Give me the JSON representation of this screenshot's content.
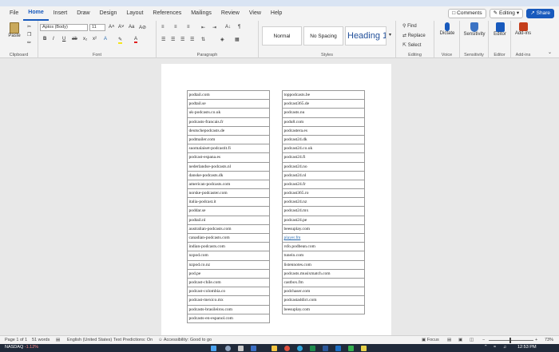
{
  "menu": {
    "items": [
      {
        "label": "File",
        "active": false
      },
      {
        "label": "Home",
        "active": true
      },
      {
        "label": "Insert",
        "active": false
      },
      {
        "label": "Draw",
        "active": false
      },
      {
        "label": "Design",
        "active": false
      },
      {
        "label": "Layout",
        "active": false
      },
      {
        "label": "References",
        "active": false
      },
      {
        "label": "Mailings",
        "active": false
      },
      {
        "label": "Review",
        "active": false
      },
      {
        "label": "View",
        "active": false
      },
      {
        "label": "Help",
        "active": false
      }
    ],
    "comments": "Comments",
    "editing": "Editing",
    "share": "Share"
  },
  "ribbon": {
    "paste": "Paste",
    "clipboard": "Clipboard",
    "font_name": "Aptos (Body)",
    "font_size": "11",
    "font": "Font",
    "paragraph": "Paragraph",
    "styles": "Styles",
    "style_normal": "Normal",
    "style_nospacing": "No Spacing",
    "style_heading": "Heading 1",
    "find": "Find",
    "replace": "Replace",
    "select": "Select",
    "editing": "Editing",
    "dictate": "Dictate",
    "voice": "Voice",
    "sensitivity": "Sensitivity",
    "sensitivity_group": "Sensitivity",
    "editor": "Editor",
    "editor_group": "Editor",
    "addins": "Add-ins",
    "addins_group": "Add-ins"
  },
  "table": {
    "left": [
      "podtail.com",
      "podtail.se",
      "uk-podcasts.co.uk",
      "podcasts-francais.fr",
      "deutschepodcasts.de",
      "podmailer.com",
      "suomalaiset-podcastit.fi",
      "podcast-espana.es",
      "nederlandse-podcasts.nl",
      "danske-podcasts.dk",
      "american-podcasts.com",
      "norske-podcaster.com",
      "italia-podcast.it",
      "poddar.se",
      "podtail.nl",
      "australian-podcasts.com",
      "canadian-podcasts.com",
      "indian-podcasts.com",
      "nzpod.com",
      "nzpod.co.nz",
      "pod.pe",
      "podcast-chile.com",
      "podcast-colombia.co",
      "podcast-mexico.mx",
      "podcasts-brasileiros.com",
      "podcasts-en-espanol.com"
    ],
    "right": [
      "toppodcasts.be",
      "podcast365.de",
      "podcasts.nu",
      "podu8.com",
      "podcastera.es",
      "podcast24.dk",
      "podcast24.co.uk",
      "podcast24.fi",
      "podcast24.no",
      "podcast24.nl",
      "podcast24.fr",
      "podcast365.ro",
      "podcast24.nz",
      "podcast24.mx",
      "podcast24.pe",
      "beesuplay.com",
      "player.fm",
      "rsfo.podbean.com",
      "tunein.com",
      "listennotes.com",
      "podcasts.musixmatch.com",
      "castbox.fm",
      "podchaser.com",
      "podcastaddict.com",
      "beesuplay.com"
    ],
    "right_links": [
      16
    ]
  },
  "status": {
    "page": "Page 1 of 1",
    "words": "51 words",
    "language": "English (United States)",
    "predictions": "Text Predictions: On",
    "accessibility": "Accessibility: Good to go",
    "focus": "Focus",
    "zoom": "73%"
  },
  "taskbar": {
    "ticker": "NASDAQ",
    "ticker_change": "-1.12%",
    "time": "12:53 PM"
  }
}
